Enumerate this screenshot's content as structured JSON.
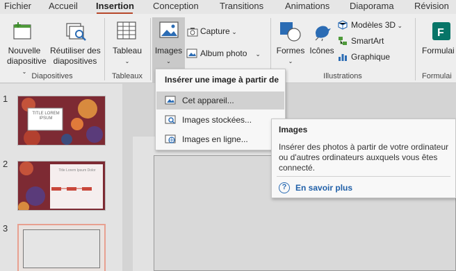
{
  "tabs": [
    "Fichier",
    "Accueil",
    "Insertion",
    "Conception",
    "Transitions",
    "Animations",
    "Diaporama",
    "Révision"
  ],
  "ribbon": {
    "new_slide": "Nouvelle diapositive",
    "new_slide_l1": "Nouvelle",
    "new_slide_l2": "diapositive",
    "reuse_l1": "Réutiliser des",
    "reuse_l2": "diapositives",
    "table": "Tableau",
    "images": "Images",
    "capture": "Capture",
    "album": "Album photo",
    "shapes": "Formes",
    "icons": "Icônes",
    "models3d": "Modèles 3D",
    "smartart": "SmartArt",
    "chart": "Graphique",
    "forms": "Formulai",
    "groups": {
      "slides": "Diapositives",
      "tables": "Tableaux",
      "illustrations": "Illustrations",
      "forms": "Formulai"
    }
  },
  "dropdown": {
    "title": "Insérer une image à partir de",
    "items": [
      "Cet appareil...",
      "Images stockées...",
      "Images en ligne..."
    ]
  },
  "tooltip": {
    "title": "Images",
    "body": "Insérer des photos à partir de votre ordinateur ou d'autres ordinateurs auxquels vous êtes connecté.",
    "link": "En savoir plus"
  },
  "slides": {
    "numbers": [
      "1",
      "2",
      "3"
    ],
    "title1": "TITLE LOREM IPSUM",
    "title2": "Title Lorem Ipsum Dolor"
  },
  "colors": {
    "accent": "#b7472a",
    "link": "#1f5fa8"
  }
}
